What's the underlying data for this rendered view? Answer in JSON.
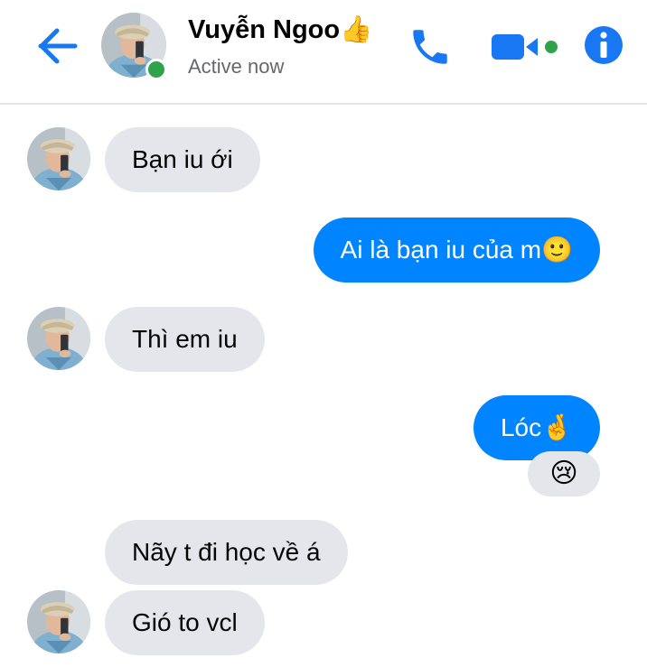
{
  "header": {
    "contact_name": "Vuyễn Ngoo",
    "name_emoji": "👍",
    "status": "Active now"
  },
  "colors": {
    "accent": "#0084ff",
    "icon_blue": "#1877f2",
    "incoming_bubble": "#e4e6eb",
    "online": "#31a24c"
  },
  "messages": [
    {
      "direction": "incoming",
      "text": "Bạn iu ới"
    },
    {
      "direction": "outgoing",
      "text": "Ai là bạn iu của m",
      "emoji": "🙂"
    },
    {
      "direction": "incoming",
      "text": "Thì em iu"
    },
    {
      "direction": "outgoing",
      "text": "Lóc",
      "emoji": "🤞",
      "reaction": "😢"
    },
    {
      "direction": "incoming",
      "text": "Nãy t đi học về á"
    },
    {
      "direction": "incoming",
      "text": "Gió to vcl"
    }
  ],
  "icons": {
    "back": "arrow-left-icon",
    "call": "phone-icon",
    "video": "video-camera-icon",
    "info": "info-icon"
  }
}
